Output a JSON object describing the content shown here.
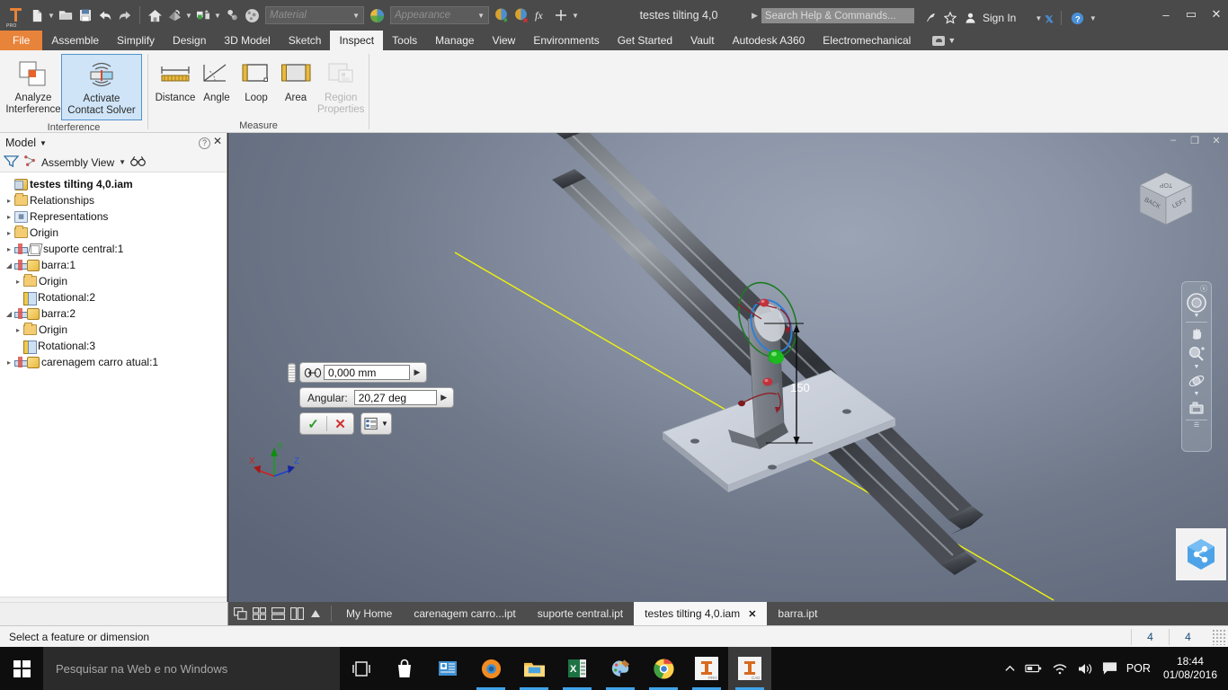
{
  "titlebar": {
    "app_icon": "inventor-pro-icon",
    "app_icon_sub": "PRO",
    "document_title": "testes tilting 4,0",
    "search_placeholder": "Search Help & Commands...",
    "sign_in_label": "Sign In",
    "material_combo": "Material",
    "appearance_combo": "Appearance",
    "quick_access": [
      {
        "name": "new-document-button",
        "glyph": "new-file-icon"
      },
      {
        "name": "open-button",
        "glyph": "open-folder-icon"
      },
      {
        "name": "save-button",
        "glyph": "save-icon"
      },
      {
        "name": "undo-button",
        "glyph": "undo-arrow-icon"
      },
      {
        "name": "redo-button",
        "glyph": "redo-arrow-icon"
      },
      {
        "name": "home-button",
        "glyph": "home-icon"
      },
      {
        "name": "return-button",
        "glyph": "return-icon"
      },
      {
        "name": "update-button",
        "glyph": "update-icon"
      },
      {
        "name": "select-button",
        "glyph": "select-icon"
      },
      {
        "name": "appearance-browser-button",
        "glyph": "sphere-icon"
      }
    ],
    "window_buttons": {
      "minimize": "–",
      "maximize": "▭",
      "close": "✕"
    }
  },
  "ribbon_tabs": [
    {
      "label": "File",
      "active": false,
      "style": "file"
    },
    {
      "label": "Assemble",
      "active": false
    },
    {
      "label": "Simplify",
      "active": false
    },
    {
      "label": "Design",
      "active": false
    },
    {
      "label": "3D Model",
      "active": false
    },
    {
      "label": "Sketch",
      "active": false
    },
    {
      "label": "Inspect",
      "active": true
    },
    {
      "label": "Tools",
      "active": false
    },
    {
      "label": "Manage",
      "active": false
    },
    {
      "label": "View",
      "active": false
    },
    {
      "label": "Environments",
      "active": false
    },
    {
      "label": "Get Started",
      "active": false
    },
    {
      "label": "Vault",
      "active": false
    },
    {
      "label": "Autodesk A360",
      "active": false
    },
    {
      "label": "Electromechanical",
      "active": false
    }
  ],
  "ribbon": {
    "panels": [
      {
        "title": "Interference",
        "buttons": [
          {
            "label": "Analyze\nInterference",
            "line1": "Analyze",
            "line2": "Interference",
            "icon": "analyze-interference-icon",
            "selected": false,
            "disabled": false
          },
          {
            "label": "Activate\nContact Solver",
            "line1": "Activate",
            "line2": "Contact Solver",
            "icon": "activate-contact-solver-icon",
            "selected": true,
            "disabled": false
          }
        ]
      },
      {
        "title": "Measure",
        "buttons": [
          {
            "line1": "Distance",
            "line2": "",
            "icon": "distance-icon",
            "selected": false,
            "disabled": false
          },
          {
            "line1": "Angle",
            "line2": "",
            "icon": "angle-icon",
            "selected": false,
            "disabled": false
          },
          {
            "line1": "Loop",
            "line2": "",
            "icon": "loop-icon",
            "selected": false,
            "disabled": false
          },
          {
            "line1": "Area",
            "line2": "",
            "icon": "area-icon",
            "selected": false,
            "disabled": false
          },
          {
            "line1": "Region Properties",
            "line2": "",
            "icon": "region-properties-icon",
            "selected": false,
            "disabled": true
          }
        ]
      }
    ]
  },
  "browser": {
    "title": "Model",
    "view_selector": "Assembly View",
    "filter_icon": "filter-funnel-icon",
    "find_icon": "binoculars-icon",
    "help_icon": "question-mark-icon",
    "close_icon": "close-icon",
    "tree": [
      {
        "label": "testes tilting 4,0.iam",
        "indent": 0,
        "expander": "",
        "icon": "assembly-icon",
        "bold": true
      },
      {
        "label": "Relationships",
        "indent": 0,
        "expander": "▸",
        "icon": "folder-icon",
        "bold": false
      },
      {
        "label": "Representations",
        "indent": 0,
        "expander": "▸",
        "icon": "representation-icon",
        "bold": false
      },
      {
        "label": "Origin",
        "indent": 0,
        "expander": "▸",
        "icon": "folder-icon",
        "bold": false
      },
      {
        "label": "suporte central:1",
        "indent": 0,
        "expander": "▸",
        "icon": "suppressed-part-icon",
        "bold": false
      },
      {
        "label": "barra:1",
        "indent": 0,
        "expander": "◢",
        "icon": "part-icon",
        "bold": false
      },
      {
        "label": "Origin",
        "indent": 1,
        "expander": "▸",
        "icon": "folder-icon",
        "bold": false
      },
      {
        "label": "Rotational:2",
        "indent": 1,
        "expander": "",
        "icon": "rotational-joint-icon",
        "bold": false
      },
      {
        "label": "barra:2",
        "indent": 0,
        "expander": "◢",
        "icon": "part-icon",
        "bold": false
      },
      {
        "label": "Origin",
        "indent": 1,
        "expander": "▸",
        "icon": "folder-icon",
        "bold": false
      },
      {
        "label": "Rotational:3",
        "indent": 1,
        "expander": "",
        "icon": "rotational-joint-icon",
        "bold": false
      },
      {
        "label": "carenagem carro atual:1",
        "indent": 0,
        "expander": "▸",
        "icon": "part-icon",
        "bold": false
      }
    ]
  },
  "viewport": {
    "window_buttons": {
      "minimize": "–",
      "restore": "❐",
      "close": "✕"
    },
    "dimension_label": "150",
    "viewcube": {
      "top_face": "TOP",
      "left_face": "BACK",
      "right_face": "LEFT"
    },
    "axis_triad": {
      "x": "X",
      "y": "Y",
      "z": "Z"
    },
    "navbar_items": [
      {
        "name": "full-navigation-wheel-icon"
      },
      {
        "name": "pan-hand-icon"
      },
      {
        "name": "zoom-magnifier-icon"
      },
      {
        "name": "orbit-icon"
      },
      {
        "name": "look-at-camera-icon"
      }
    ],
    "a360_icon": "a360-share-icon",
    "colors": {
      "yellow_axis": "#f2f20d",
      "green_gizmo": "#1aa81a",
      "blue_gizmo": "#2f7fd4",
      "dark_green_ring": "#1e7a23",
      "red_handle": "#b5222b",
      "bar_dark": "#3c4046",
      "plate_light": "#c9ced9"
    }
  },
  "minitoolbar": {
    "offset_value": "0,000 mm",
    "offset_glyph": "axis-offset-icon",
    "angular_label": "Angular:",
    "angular_value": "20,27 deg",
    "ok_glyph": "✓",
    "cancel_glyph": "✕",
    "options_glyph": "options-list-icon",
    "dropdown_glyph": "▶"
  },
  "doctabs": {
    "layout_icons": [
      {
        "name": "cascade-windows-icon"
      },
      {
        "name": "tile-windows-icon"
      },
      {
        "name": "tile-horizontal-icon"
      },
      {
        "name": "tile-vertical-icon"
      },
      {
        "name": "tab-scroll-up-icon"
      }
    ],
    "tabs": [
      {
        "label": "My Home",
        "active": false,
        "closable": false
      },
      {
        "label": "carenagem carro...ipt",
        "active": false,
        "closable": false
      },
      {
        "label": "suporte central.ipt",
        "active": false,
        "closable": false
      },
      {
        "label": "testes tilting 4,0.iam",
        "active": true,
        "closable": true,
        "close": "✕"
      },
      {
        "label": "barra.ipt",
        "active": false,
        "closable": false
      }
    ]
  },
  "statusbar": {
    "message": "Select a feature or dimension",
    "cell_1": "4",
    "cell_2": "4",
    "grip": "resize-grip-icon"
  },
  "taskbar": {
    "start_icon": "windows-start-icon",
    "search_placeholder": "Pesquisar na Web e no Windows",
    "apps": [
      {
        "name": "task-view-icon",
        "active": false
      },
      {
        "name": "windows-store-icon",
        "active": false
      },
      {
        "name": "contacts-icon",
        "active": false
      },
      {
        "name": "firefox-icon",
        "active": false,
        "running": true
      },
      {
        "name": "file-explorer-icon",
        "active": false,
        "running": true
      },
      {
        "name": "excel-icon",
        "active": false,
        "running": true
      },
      {
        "name": "paint-icon",
        "active": false,
        "running": true
      },
      {
        "name": "chrome-icon",
        "active": false,
        "running": true
      },
      {
        "name": "inventor-pro-icon",
        "active": false,
        "running": true
      },
      {
        "name": "inventor-cad-icon",
        "active": true,
        "running": true
      }
    ],
    "tray": [
      {
        "name": "show-hidden-icons-icon",
        "glyph": "∧"
      },
      {
        "name": "battery-icon"
      },
      {
        "name": "wifi-icon"
      },
      {
        "name": "volume-icon"
      },
      {
        "name": "action-center-icon"
      }
    ],
    "language": "POR",
    "time": "18:44",
    "date": "01/08/2016"
  }
}
